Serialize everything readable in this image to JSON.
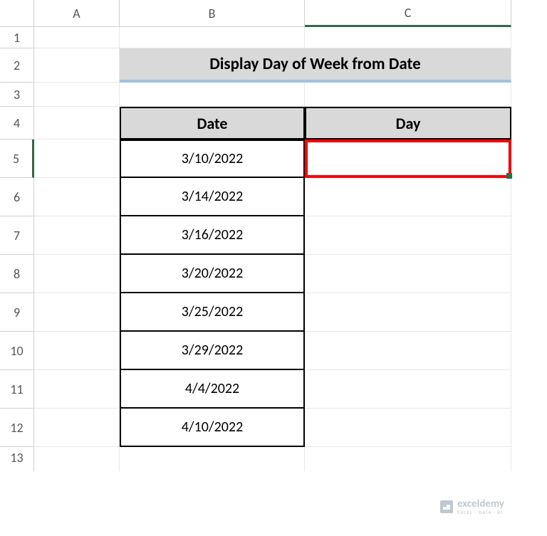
{
  "columns": [
    "A",
    "B",
    "C"
  ],
  "rows": [
    "1",
    "2",
    "3",
    "4",
    "5",
    "6",
    "7",
    "8",
    "9",
    "10",
    "11",
    "12",
    "13"
  ],
  "title": "Display Day of Week from Date",
  "headers": {
    "date": "Date",
    "day": "Day"
  },
  "data": {
    "dates": [
      "3/10/2022",
      "3/14/2022",
      "3/16/2022",
      "3/20/2022",
      "3/25/2022",
      "3/29/2022",
      "4/4/2022",
      "4/10/2022"
    ],
    "days": [
      "",
      "",
      "",
      "",
      "",
      "",
      "",
      ""
    ]
  },
  "active_cell": "C5",
  "watermark": {
    "main": "exceldemy",
    "sub": "EXCEL · DATA · BI"
  }
}
